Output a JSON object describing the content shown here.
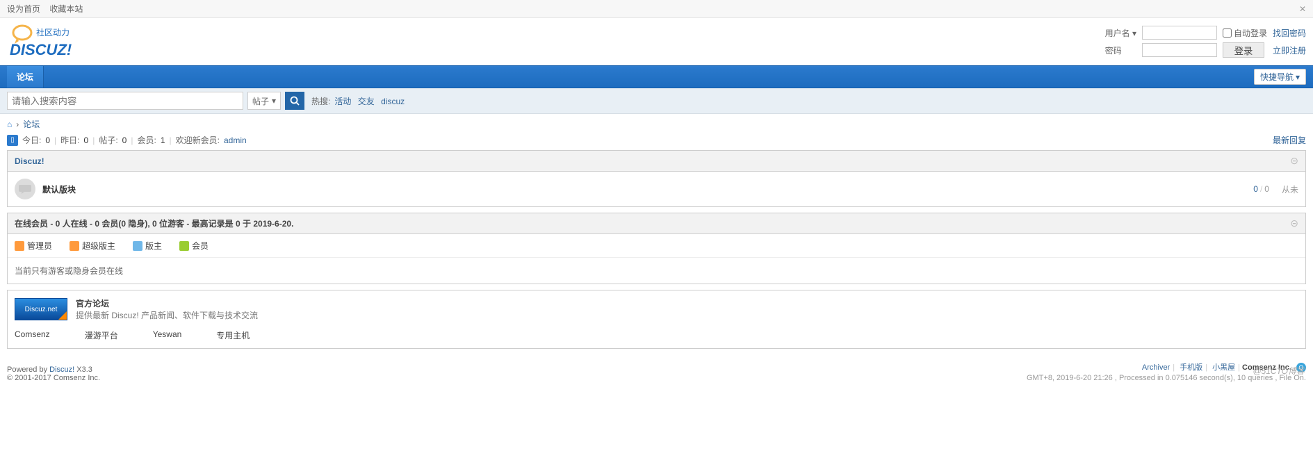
{
  "topstrip": {
    "set_home": "设为首页",
    "add_fav": "收藏本站"
  },
  "logo": {
    "tagline": "社区动力",
    "brand": "DISCUZ!"
  },
  "login": {
    "user_label": "用户名",
    "pwd_label": "密码",
    "autologin": "自动登录",
    "findpwd": "找回密码",
    "login_btn": "登录",
    "register": "立即注册"
  },
  "nav": {
    "forum": "论坛",
    "quick": "快捷导航"
  },
  "search": {
    "placeholder": "请输入搜索内容",
    "type": "帖子",
    "hot_label": "热搜:",
    "hot": [
      "活动",
      "交友",
      "discuz"
    ]
  },
  "crumb": {
    "forum": "论坛"
  },
  "stats": {
    "today_label": "今日:",
    "today": "0",
    "yesterday_label": "昨日:",
    "yesterday": "0",
    "posts_label": "帖子:",
    "posts": "0",
    "members_label": "会员:",
    "members": "1",
    "welcome": "欢迎新会员:",
    "newmember": "admin",
    "latest_reply": "最新回复"
  },
  "category": {
    "title": "Discuz!",
    "forum_name": "默认版块",
    "threads": "0",
    "posts": "0",
    "last": "从未"
  },
  "online": {
    "header": "在线会员 - 0 人在线 - 0 会员(0 隐身), 0 位游客 - 最高记录是 0 于 2019-6-20.",
    "roles": {
      "admin": "管理员",
      "smod": "超级版主",
      "mod": "版主",
      "member": "会员"
    },
    "msg": "当前只有游客或隐身会员在线"
  },
  "official": {
    "img_text": "Discuz.net",
    "title": "官方论坛",
    "desc": "提供最新 Discuz! 产品新闻、软件下载与技术交流",
    "links": [
      "Comsenz",
      "漫游平台",
      "Yeswan",
      "专用主机"
    ]
  },
  "footer": {
    "powered_prefix": "Powered by ",
    "powered_link": "Discuz!",
    "powered_ver": " X3.3",
    "copyright": "© 2001-2017 Comsenz Inc.",
    "links": [
      "Archiver",
      "手机版",
      "小黑屋"
    ],
    "company": "Comsenz Inc.",
    "timing": "GMT+8, 2019-6-20 21:26 , Processed in 0.075146 second(s), 10 queries , File On."
  },
  "watermark": "@51CTO博客"
}
